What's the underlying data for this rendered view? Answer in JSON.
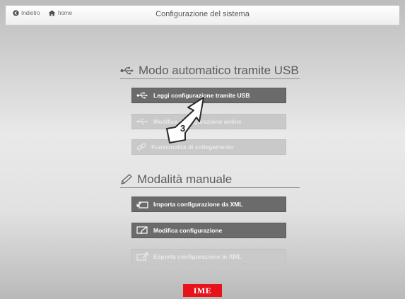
{
  "topbar": {
    "back_label": "Indietro",
    "home_label": "home",
    "title": "Configurazione del sistema"
  },
  "usb_section": {
    "title": "Modo automatico tramite USB",
    "icon": "usb-icon",
    "buttons": [
      {
        "label": "Leggi configurazione tramite USB",
        "icon": "usb-icon",
        "enabled": true
      },
      {
        "label": "Modifica configurazione online",
        "icon": "usb-icon",
        "enabled": false
      },
      {
        "label": "Funzionalità di collegamento",
        "icon": "link-icon",
        "enabled": false
      }
    ]
  },
  "manual_section": {
    "title": "Modalità manuale",
    "icon": "pencil-icon",
    "buttons": [
      {
        "label": "Importa configurazione da XML",
        "icon": "import-icon",
        "enabled": true
      },
      {
        "label": "Modifica configurazione",
        "icon": "edit-icon",
        "enabled": true
      },
      {
        "label": "Esporta configurazione in XML",
        "icon": "export-icon",
        "enabled": false
      }
    ]
  },
  "annotation": {
    "step": "3"
  },
  "logo": {
    "text": "IME",
    "color": "#e8121b"
  }
}
